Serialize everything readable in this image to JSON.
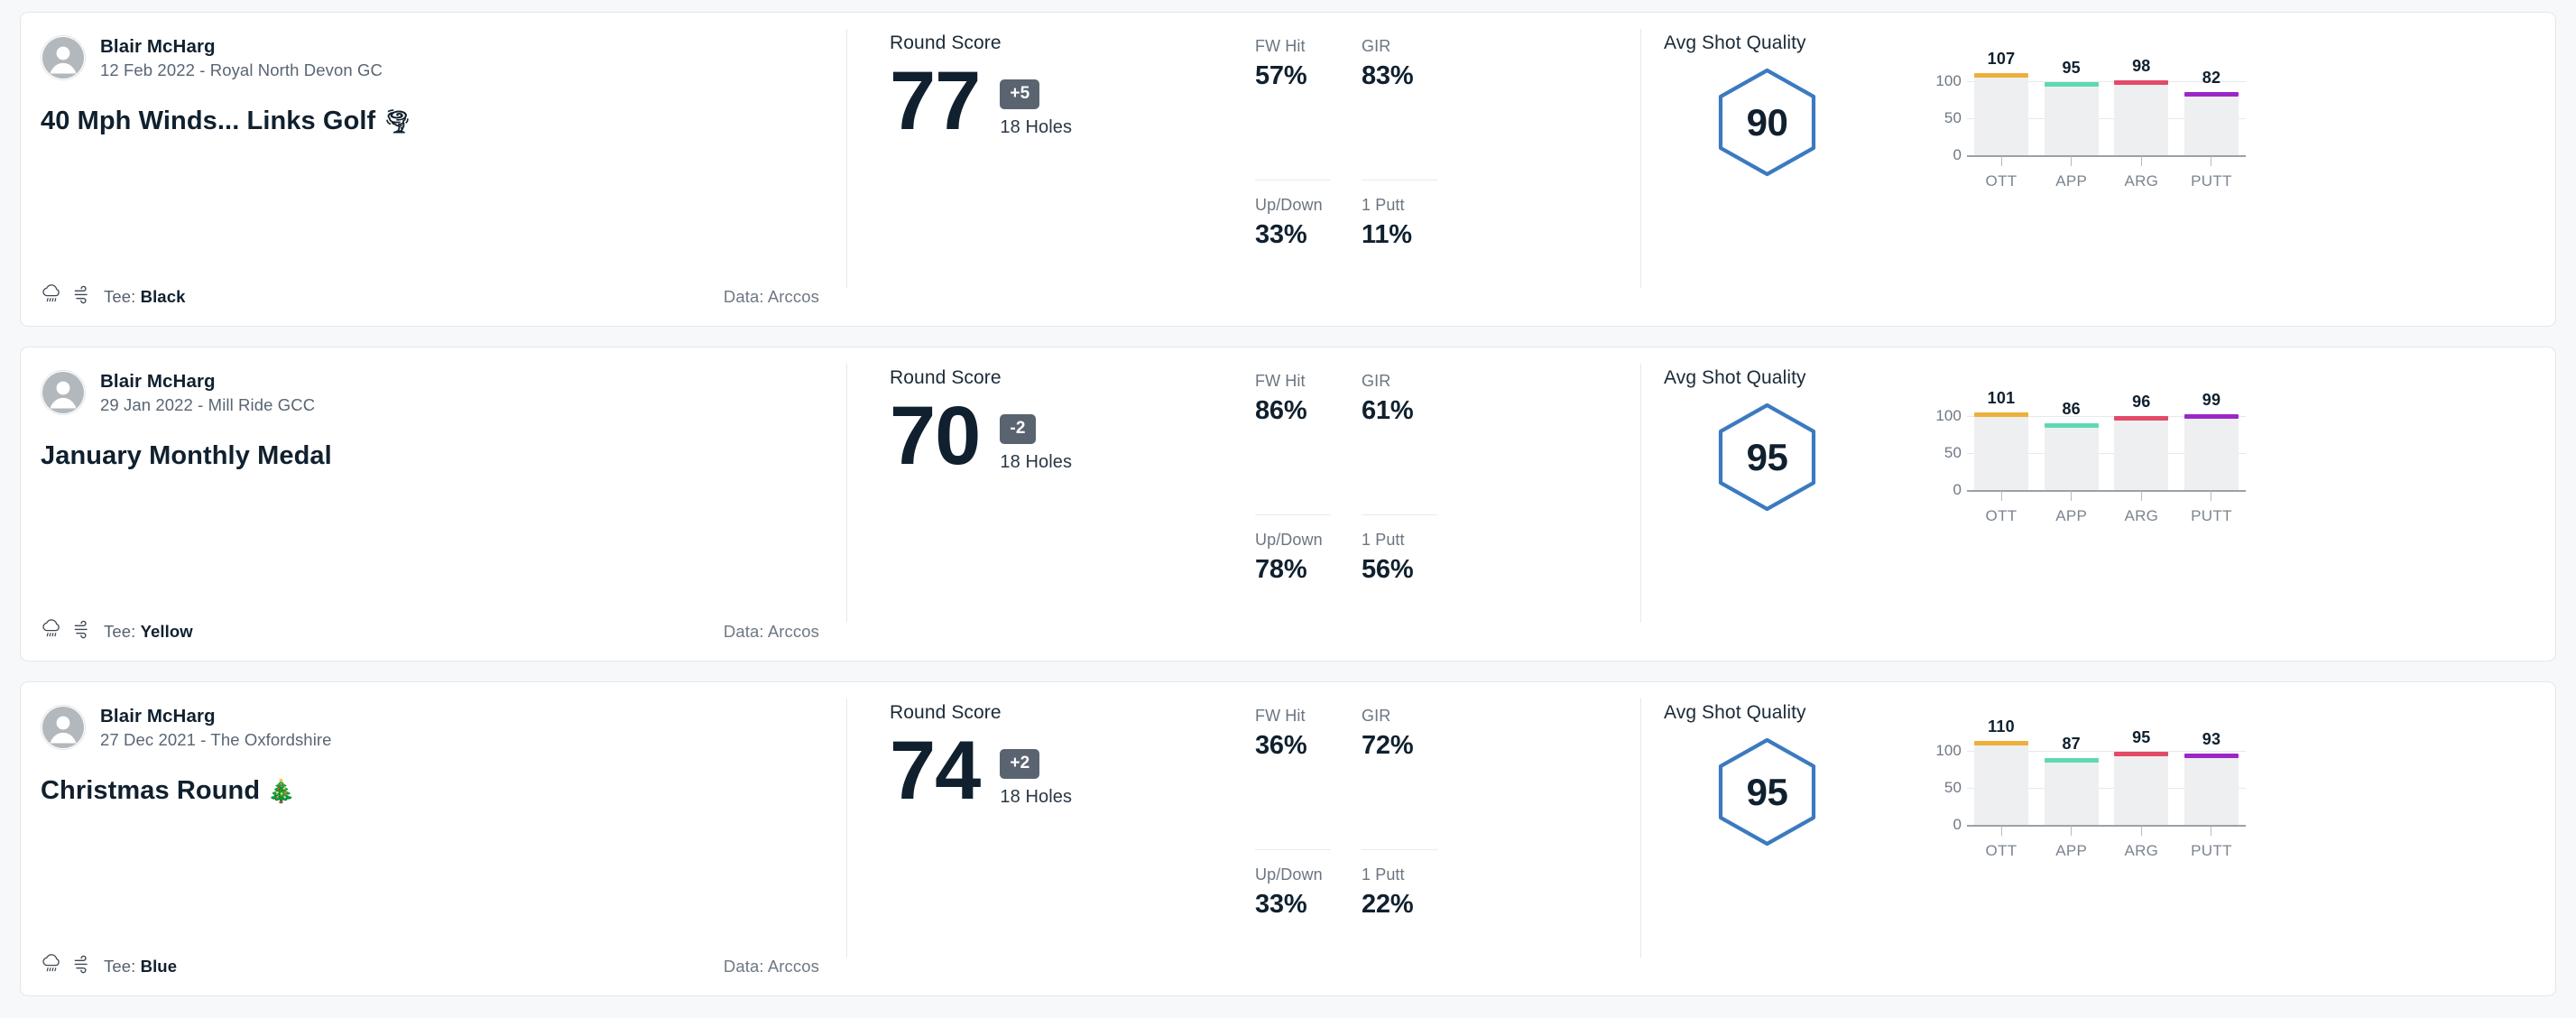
{
  "labels": {
    "round_score": "Round Score",
    "holes": "18 Holes",
    "avg_shot_quality": "Avg Shot Quality",
    "tee_prefix": "Tee:",
    "fw_hit": "FW Hit",
    "gir": "GIR",
    "up_down": "Up/Down",
    "one_putt": "1 Putt",
    "data_source": "Data: Arccos"
  },
  "icons": {
    "avatar": "user-avatar-icon",
    "weather": "rain-cloud-icon",
    "wind": "wind-icon"
  },
  "colors": {
    "hexagon": "#3b7ac0",
    "to_par_badge": "#5a6471",
    "ott": "#edb03c",
    "app": "#5ed9b2",
    "arg": "#e24a68",
    "putt": "#9b27c6",
    "bar_track": "#eeeff0",
    "text_dark": "#10202e",
    "text_muted": "#6b7581"
  },
  "chart_axis": {
    "ticks": [
      "100",
      "50",
      "0"
    ],
    "ymax": 125,
    "grid": true
  },
  "rounds": [
    {
      "player": "Blair McHarg",
      "meta": "12 Feb 2022 - Royal North Devon GC",
      "title": "40 Mph Winds... Links Golf",
      "title_emoji": "🌪",
      "tee": "Black",
      "data_source": "Data: Arccos",
      "score": "77",
      "to_par": "+5",
      "holes": "18 Holes",
      "stats": {
        "fw_hit": "57%",
        "gir": "83%",
        "up_down": "33%",
        "one_putt": "11%"
      },
      "avg_shot_quality": "90",
      "chart_data": {
        "type": "bar",
        "title": "Avg Shot Quality",
        "categories": [
          "OTT",
          "APP",
          "ARG",
          "PUTT"
        ],
        "values": [
          107,
          95,
          98,
          82
        ],
        "colors": [
          "#edb03c",
          "#5ed9b2",
          "#e24a68",
          "#9b27c6"
        ],
        "xlabel": "",
        "ylabel": "",
        "ylim": [
          0,
          125
        ],
        "yticks": [
          0,
          50,
          100
        ],
        "grid": true,
        "legend": "none"
      }
    },
    {
      "player": "Blair McHarg",
      "meta": "29 Jan 2022 - Mill Ride GCC",
      "title": "January Monthly Medal",
      "title_emoji": "",
      "tee": "Yellow",
      "data_source": "Data: Arccos",
      "score": "70",
      "to_par": "-2",
      "holes": "18 Holes",
      "stats": {
        "fw_hit": "86%",
        "gir": "61%",
        "up_down": "78%",
        "one_putt": "56%"
      },
      "avg_shot_quality": "95",
      "chart_data": {
        "type": "bar",
        "title": "Avg Shot Quality",
        "categories": [
          "OTT",
          "APP",
          "ARG",
          "PUTT"
        ],
        "values": [
          101,
          86,
          96,
          99
        ],
        "colors": [
          "#edb03c",
          "#5ed9b2",
          "#e24a68",
          "#9b27c6"
        ],
        "xlabel": "",
        "ylabel": "",
        "ylim": [
          0,
          125
        ],
        "yticks": [
          0,
          50,
          100
        ],
        "grid": true,
        "legend": "none"
      }
    },
    {
      "player": "Blair McHarg",
      "meta": "27 Dec 2021 - The Oxfordshire",
      "title": "Christmas Round",
      "title_emoji": "🎄",
      "tee": "Blue",
      "data_source": "Data: Arccos",
      "score": "74",
      "to_par": "+2",
      "holes": "18 Holes",
      "stats": {
        "fw_hit": "36%",
        "gir": "72%",
        "up_down": "33%",
        "one_putt": "22%"
      },
      "avg_shot_quality": "95",
      "chart_data": {
        "type": "bar",
        "title": "Avg Shot Quality",
        "categories": [
          "OTT",
          "APP",
          "ARG",
          "PUTT"
        ],
        "values": [
          110,
          87,
          95,
          93
        ],
        "colors": [
          "#edb03c",
          "#5ed9b2",
          "#e24a68",
          "#9b27c6"
        ],
        "xlabel": "",
        "ylabel": "",
        "ylim": [
          0,
          125
        ],
        "yticks": [
          0,
          50,
          100
        ],
        "grid": true,
        "legend": "none"
      }
    }
  ]
}
